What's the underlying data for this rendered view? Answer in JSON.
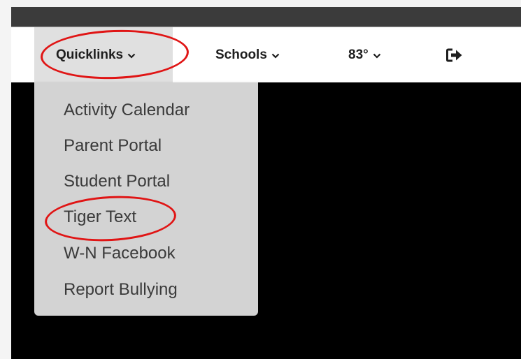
{
  "nav": {
    "quicklinks_label": "Quicklinks",
    "schools_label": "Schools",
    "weather_label": "83°",
    "logout_icon": "sign-out-icon"
  },
  "dropdown": {
    "items": [
      {
        "label": "Activity Calendar"
      },
      {
        "label": "Parent Portal"
      },
      {
        "label": "Student Portal"
      },
      {
        "label": "Tiger Text"
      },
      {
        "label": "W-N Facebook"
      },
      {
        "label": "Report Bullying"
      }
    ]
  },
  "colors": {
    "top_bar": "#3b3b3b",
    "nav_bar": "#ffffff",
    "nav_active": "#e0e0e0",
    "dropdown_bg": "#d3d3d3",
    "annotation_red": "#e01515",
    "content_bg": "#000000"
  }
}
